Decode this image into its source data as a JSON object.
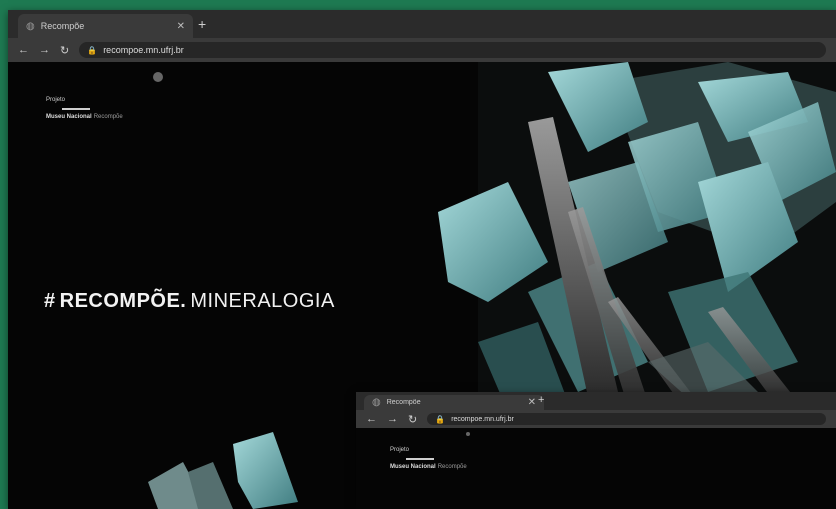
{
  "main_window": {
    "tab_title": "Recompõe",
    "url": "recompoe.mn.ufrj.br",
    "logo": {
      "top": "Projeto",
      "bottom_bold": "Museu Nacional",
      "bottom_light": "Recompõe"
    },
    "hero": {
      "hash": "#",
      "bold": "RECOMPÕE.",
      "thin": "MINERALOGIA"
    }
  },
  "secondary_window": {
    "tab_title": "Recompõe",
    "url": "recompoe.mn.ufrj.br",
    "logo": {
      "top": "Projeto",
      "bottom_bold": "Museu Nacional",
      "bottom_light": "Recompõe"
    }
  },
  "icons": {
    "favicon": "globe-icon",
    "close": "close-icon",
    "new_tab": "plus-icon",
    "back": "back-arrow-icon",
    "forward": "forward-arrow-icon",
    "reload": "reload-icon",
    "lock": "lock-icon"
  },
  "colors": {
    "background": "#1e7a52",
    "page": "#050505",
    "crystal": "#8fc7c9"
  }
}
